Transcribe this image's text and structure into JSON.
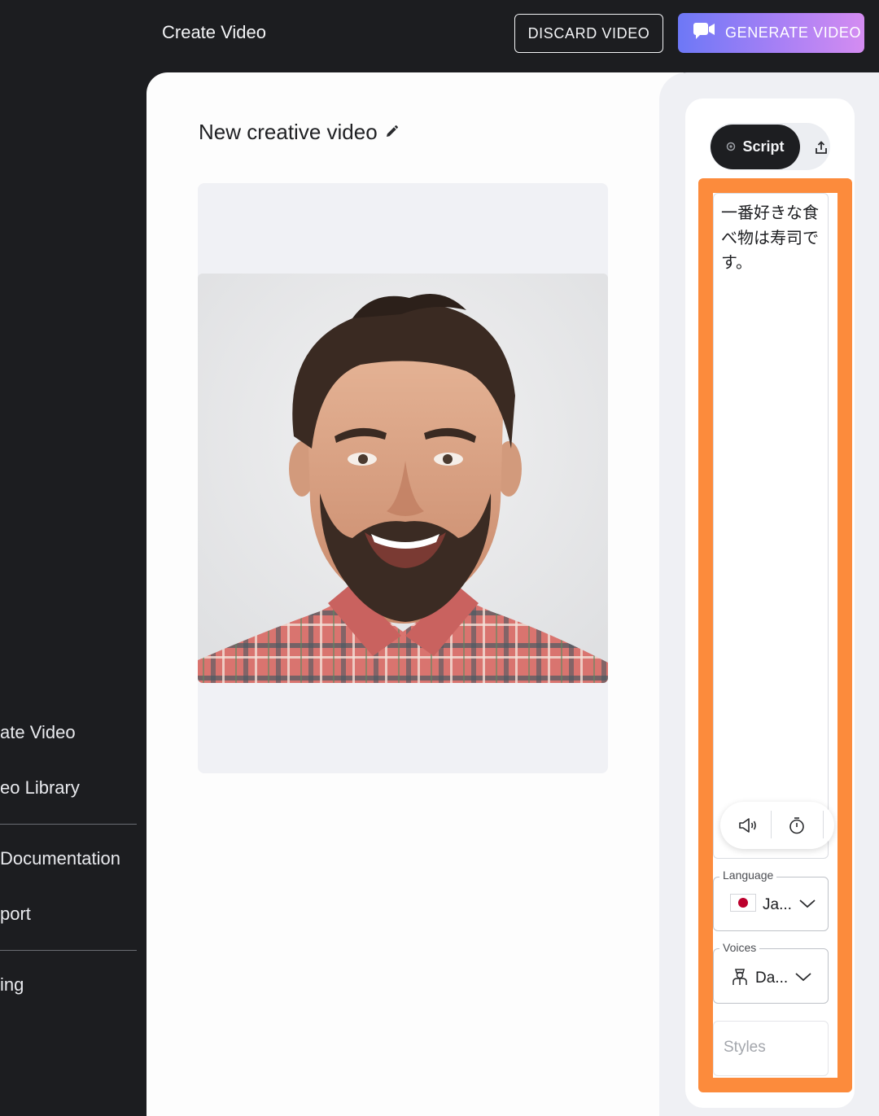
{
  "sidebar": {
    "items": [
      {
        "label": "ate Video"
      },
      {
        "label": "eo Library"
      },
      {
        "label": "Documentation"
      },
      {
        "label": "port"
      },
      {
        "label": "ing"
      }
    ]
  },
  "topbar": {
    "title": "Create Video",
    "discard_label": "DISCARD VIDEO",
    "generate_label": "GENERATE VIDEO"
  },
  "main": {
    "video_title": "New creative video"
  },
  "panel": {
    "tab_script": "Script",
    "script_text": "一番好きな食べ物は寿司です。",
    "language": {
      "label": "Language",
      "value": "Ja..."
    },
    "voices": {
      "label": "Voices",
      "value": "Da..."
    },
    "styles_placeholder": "Styles"
  },
  "colors": {
    "highlight": "#fc8b3c",
    "sidebar_bg": "#1c1d20",
    "generate_gradient_start": "#6d78f6",
    "generate_gradient_end": "#d48cf1"
  }
}
